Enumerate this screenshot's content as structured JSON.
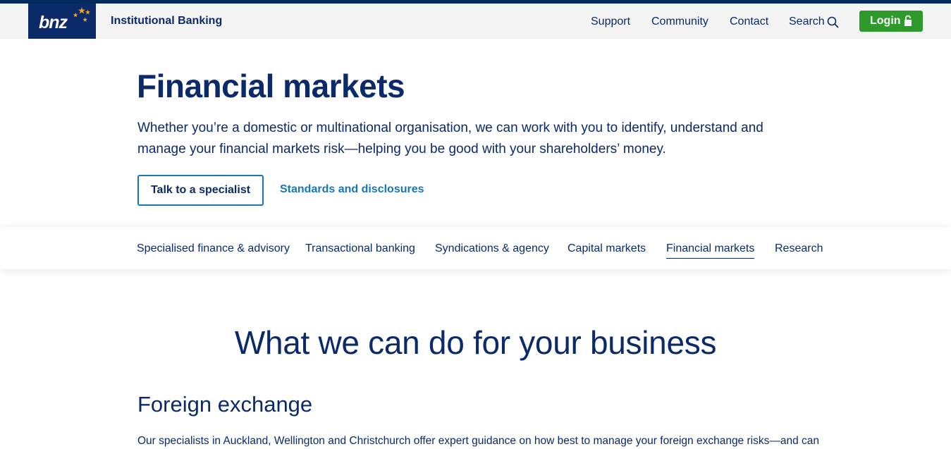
{
  "header": {
    "logo_text": "bnz",
    "brand_name": "Institutional Banking",
    "nav": {
      "support": "Support",
      "community": "Community",
      "contact": "Contact",
      "search": "Search"
    },
    "login_label": "Login",
    "colors": {
      "stripe": "#002a5c",
      "logo_bg": "#0a2a6a",
      "login_bg": "#2e9a2c",
      "stars": "#f5a623"
    }
  },
  "hero": {
    "title": "Financial markets",
    "intro": "Whether you’re a domestic or multinational organisation, we can work with you to identify, understand and manage your financial markets risk—helping you be good with your shareholders’ money.",
    "specialist_button": "Talk to a specialist",
    "standards_link": "Standards and disclosures"
  },
  "subnav": {
    "items": [
      "Specialised finance & advisory",
      "Transactional banking",
      "Syndications & agency",
      "Capital markets",
      "Financial markets",
      "Research"
    ],
    "active": "Financial markets"
  },
  "content": {
    "section_heading": "What we can do for your business",
    "fx_heading": "Foreign exchange",
    "fx_body": "Our specialists in Auckland, Wellington and Christchurch offer expert guidance on how best to manage your foreign exchange risks—and can"
  },
  "icons": {
    "logo_stars": "stars-icon",
    "search": "search-icon",
    "login_lock": "lock-icon"
  }
}
